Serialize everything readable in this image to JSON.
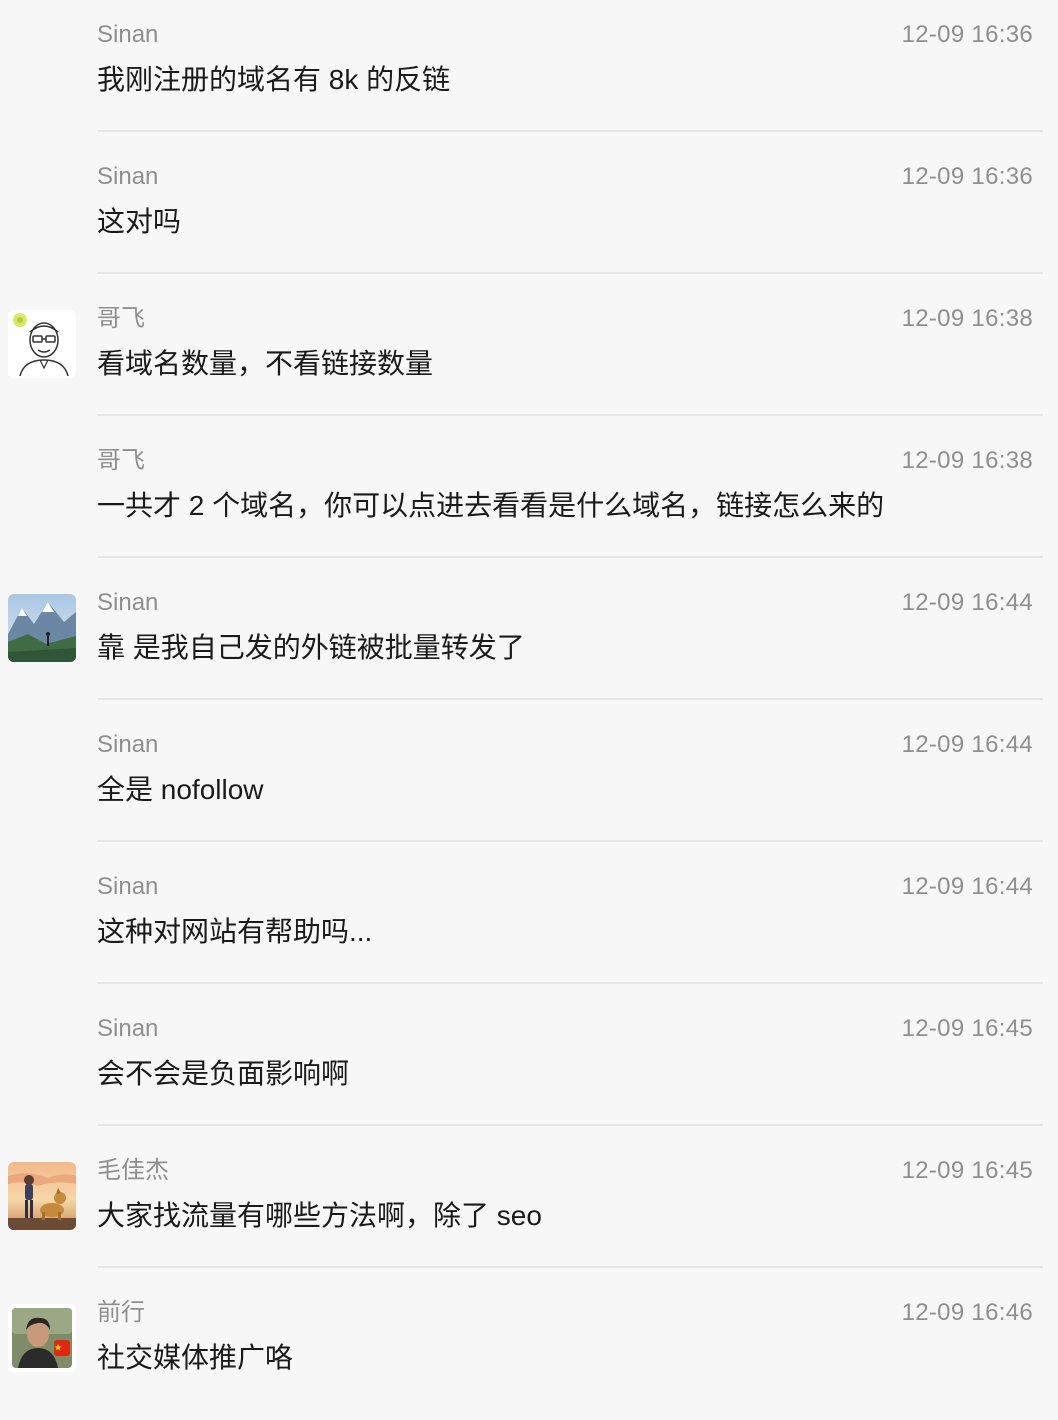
{
  "messages": [
    {
      "sender": "Sinan",
      "time": "12-09 16:36",
      "text": "我刚注册的域名有 8k 的反链",
      "avatar": ""
    },
    {
      "sender": "Sinan",
      "time": "12-09 16:36",
      "text": "这对吗",
      "avatar": ""
    },
    {
      "sender": "哥飞",
      "time": "12-09 16:38",
      "text": "看域名数量，不看链接数量",
      "avatar": "cartoon-glasses-man"
    },
    {
      "sender": "哥飞",
      "time": "12-09 16:38",
      "text": "一共才 2 个域名，你可以点进去看看是什么域名，链接怎么来的",
      "avatar": ""
    },
    {
      "sender": "Sinan",
      "time": "12-09 16:44",
      "text": "靠 是我自己发的外链被批量转发了",
      "avatar": "mountain-landscape"
    },
    {
      "sender": "Sinan",
      "time": "12-09 16:44",
      "text": "全是 nofollow",
      "avatar": ""
    },
    {
      "sender": "Sinan",
      "time": "12-09 16:44",
      "text": "这种对网站有帮助吗...",
      "avatar": ""
    },
    {
      "sender": "Sinan",
      "time": "12-09 16:45",
      "text": "会不会是负面影响啊",
      "avatar": ""
    },
    {
      "sender": "毛佳杰",
      "time": "12-09 16:45",
      "text": "大家找流量有哪些方法啊，除了 seo",
      "avatar": "sunset-boy-and-dog"
    },
    {
      "sender": "前行",
      "time": "12-09 16:46",
      "text": "社交媒体推广咯",
      "avatar": "man-photo-with-flag"
    }
  ],
  "colors": {
    "background": "#f7f7f7",
    "sender": "#8f8f8f",
    "time": "#8f8f8f",
    "text": "#1a1a1a",
    "divider": "#e6e6e6"
  }
}
